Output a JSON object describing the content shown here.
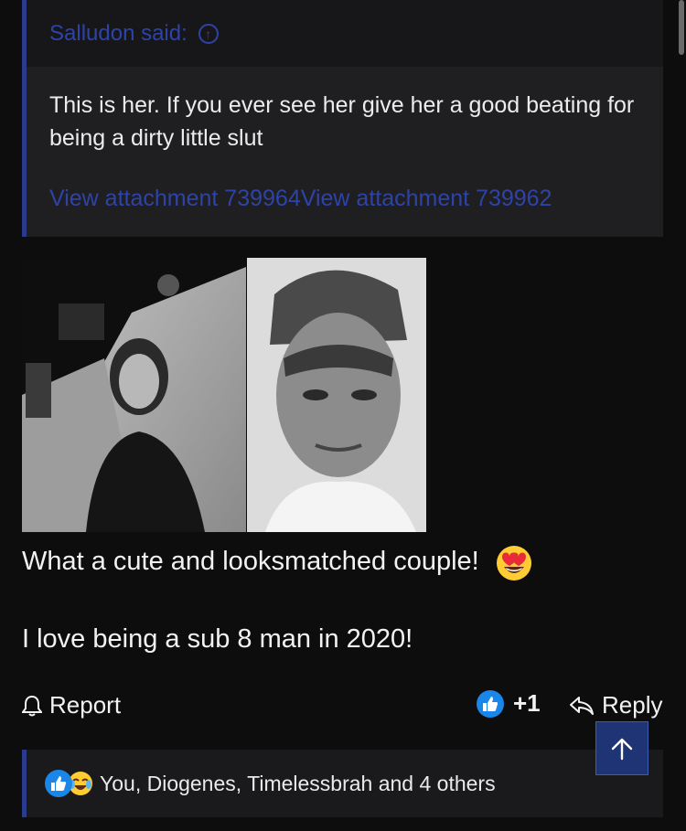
{
  "quote": {
    "author_said": "Salludon said:",
    "body": "This is her. If you ever see her give her a good beating for being a dirty little slut",
    "attachments": "View attachment 739964View attachment 739962"
  },
  "post": {
    "line1": "What a cute and looksmatched couple!",
    "line2": "I love being a sub 8 man in 2020!"
  },
  "actions": {
    "report": "Report",
    "like_count": "+1",
    "reply": "Reply"
  },
  "reactions": {
    "summary": "You, Diogenes, Timelessbrah and 4 others"
  },
  "colors": {
    "link": "#2e43a8",
    "like_blue": "#1a86e8",
    "accent_border": "#2a3a8c"
  }
}
